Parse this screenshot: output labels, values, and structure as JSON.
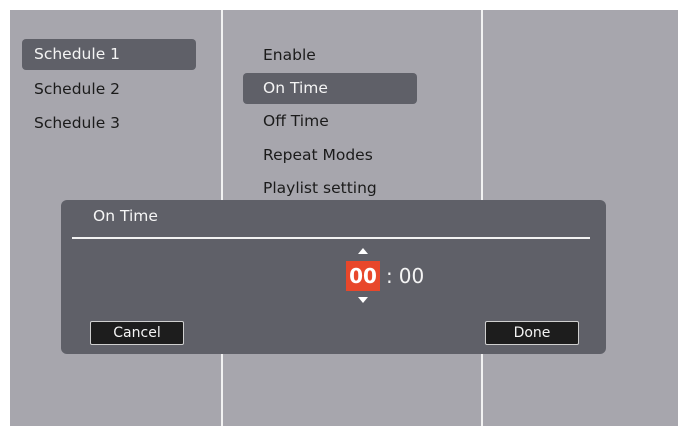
{
  "schedules": {
    "items": [
      {
        "label": "Schedule 1",
        "selected": true
      },
      {
        "label": "Schedule 2",
        "selected": false
      },
      {
        "label": "Schedule 3",
        "selected": false
      }
    ]
  },
  "settings": {
    "items": [
      {
        "label": "Enable",
        "selected": false
      },
      {
        "label": "On Time",
        "selected": true
      },
      {
        "label": "Off Time",
        "selected": false
      },
      {
        "label": "Repeat Modes",
        "selected": false
      },
      {
        "label": "Playlist setting",
        "selected": false
      }
    ]
  },
  "dialog": {
    "title": "On Time",
    "hour": "00",
    "separator": ":",
    "minute": "00",
    "cancel_label": "Cancel",
    "done_label": "Done"
  },
  "colors": {
    "background": "#a7a6ad",
    "selection": "#5f6068",
    "hour_highlight": "#e8472b"
  }
}
